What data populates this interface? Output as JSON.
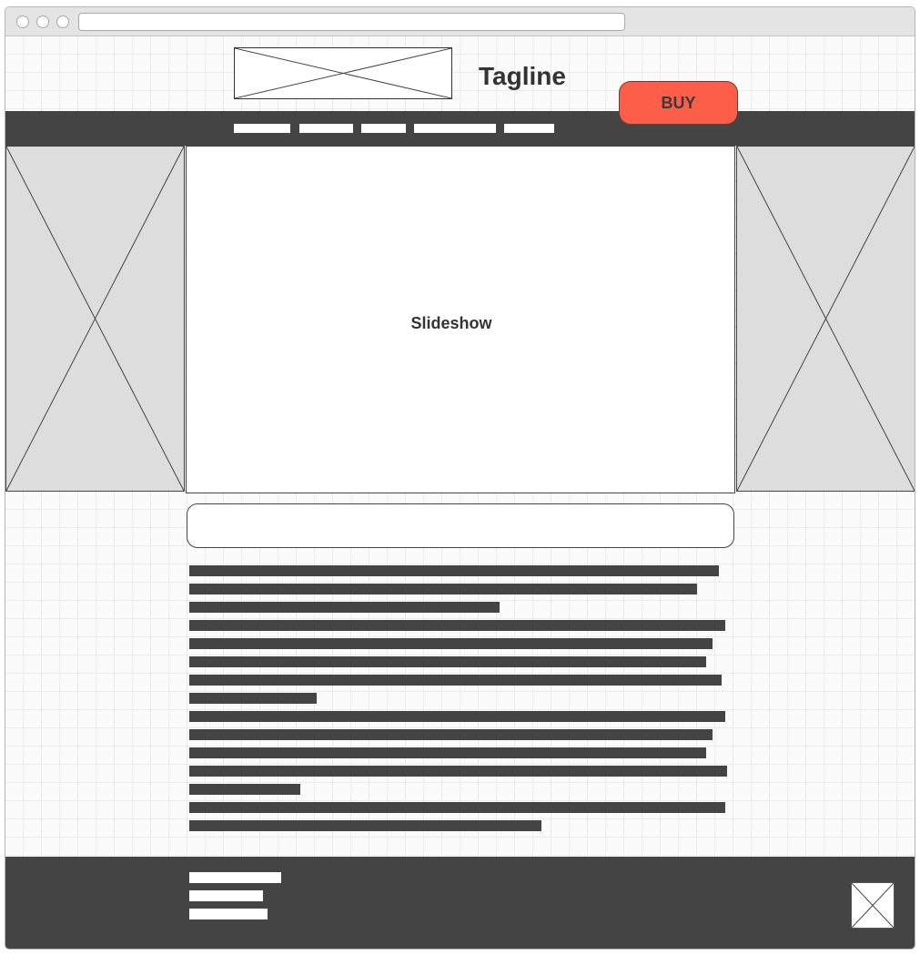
{
  "browser": {
    "window_controls": [
      "close",
      "minimize",
      "maximize"
    ],
    "url": ""
  },
  "header": {
    "logo": "logo-placeholder-image",
    "tagline": "Tagline",
    "buy_label": "BUY",
    "buy_color": "#fd5e47"
  },
  "nav": {
    "bar_color": "#444444",
    "items": [
      "",
      "",
      "",
      "",
      ""
    ]
  },
  "main": {
    "left_image": "placeholder-image",
    "slideshow_label": "Slideshow",
    "right_image": "placeholder-image",
    "caption": "",
    "text_lines_count": 15
  },
  "footer": {
    "bar_color": "#444444",
    "links": [
      "",
      "",
      ""
    ],
    "logo": "placeholder-image"
  }
}
